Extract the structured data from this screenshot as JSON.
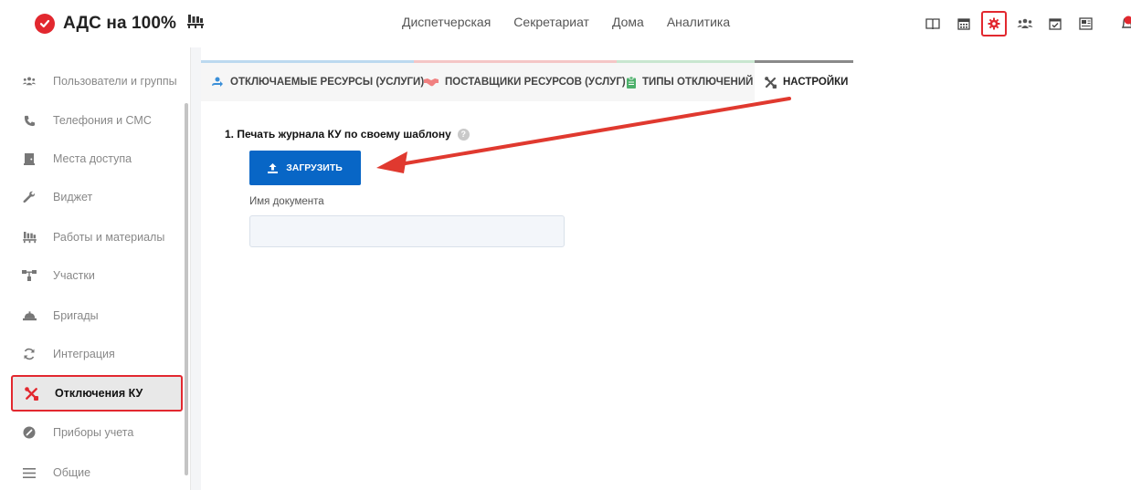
{
  "app": {
    "title": "АДС на 100%"
  },
  "nav": {
    "items": [
      "Диспетчерская",
      "Секретариат",
      "Дома",
      "Аналитика"
    ]
  },
  "toolbar": {
    "icons": [
      "book-icon",
      "calendar-icon",
      "settings-gear-icon",
      "users-icon",
      "calendar-check-icon",
      "newspaper-icon",
      "bell-icon"
    ],
    "active_icon": "settings-gear-icon"
  },
  "sidebar": {
    "items": [
      {
        "label": "Пользователи и группы",
        "icon": "users-icon"
      },
      {
        "label": "Телефония и СМС",
        "icon": "phone-icon"
      },
      {
        "label": "Места доступа",
        "icon": "door-icon"
      },
      {
        "label": "Виджет",
        "icon": "wrench-icon"
      },
      {
        "label": "Работы и материалы",
        "icon": "pallet-icon"
      },
      {
        "label": "Участки",
        "icon": "hierarchy-icon"
      },
      {
        "label": "Бригады",
        "icon": "helmet-icon"
      },
      {
        "label": "Интеграция",
        "icon": "sync-icon"
      },
      {
        "label": "Отключения КУ",
        "icon": "tools-icon"
      },
      {
        "label": "Приборы учета",
        "icon": "gauge-icon"
      },
      {
        "label": "Общие",
        "icon": "menu-icon"
      }
    ],
    "active_index": 8
  },
  "tabs": [
    {
      "label": "ОТКЛЮЧАЕМЫЕ РЕСУРСЫ (УСЛУГИ)",
      "icon": "tap-icon"
    },
    {
      "label": "ПОСТАВЩИКИ РЕСУРСОВ (УСЛУГ)",
      "icon": "handshake-icon"
    },
    {
      "label": "ТИПЫ ОТКЛЮЧЕНИЙ",
      "icon": "clipboard-icon"
    },
    {
      "label": "НАСТРОЙКИ",
      "icon": "tools-icon"
    }
  ],
  "settings": {
    "section_title": "1. Печать журнала КУ по своему шаблону",
    "help_mark": "?",
    "upload_label": "ЗАГРУЗИТЬ",
    "doc_name_label": "Имя документа",
    "doc_name_value": ""
  },
  "colors": {
    "brand": "#e2282f",
    "primary": "#0866c6",
    "highlight": "#e2282f"
  }
}
